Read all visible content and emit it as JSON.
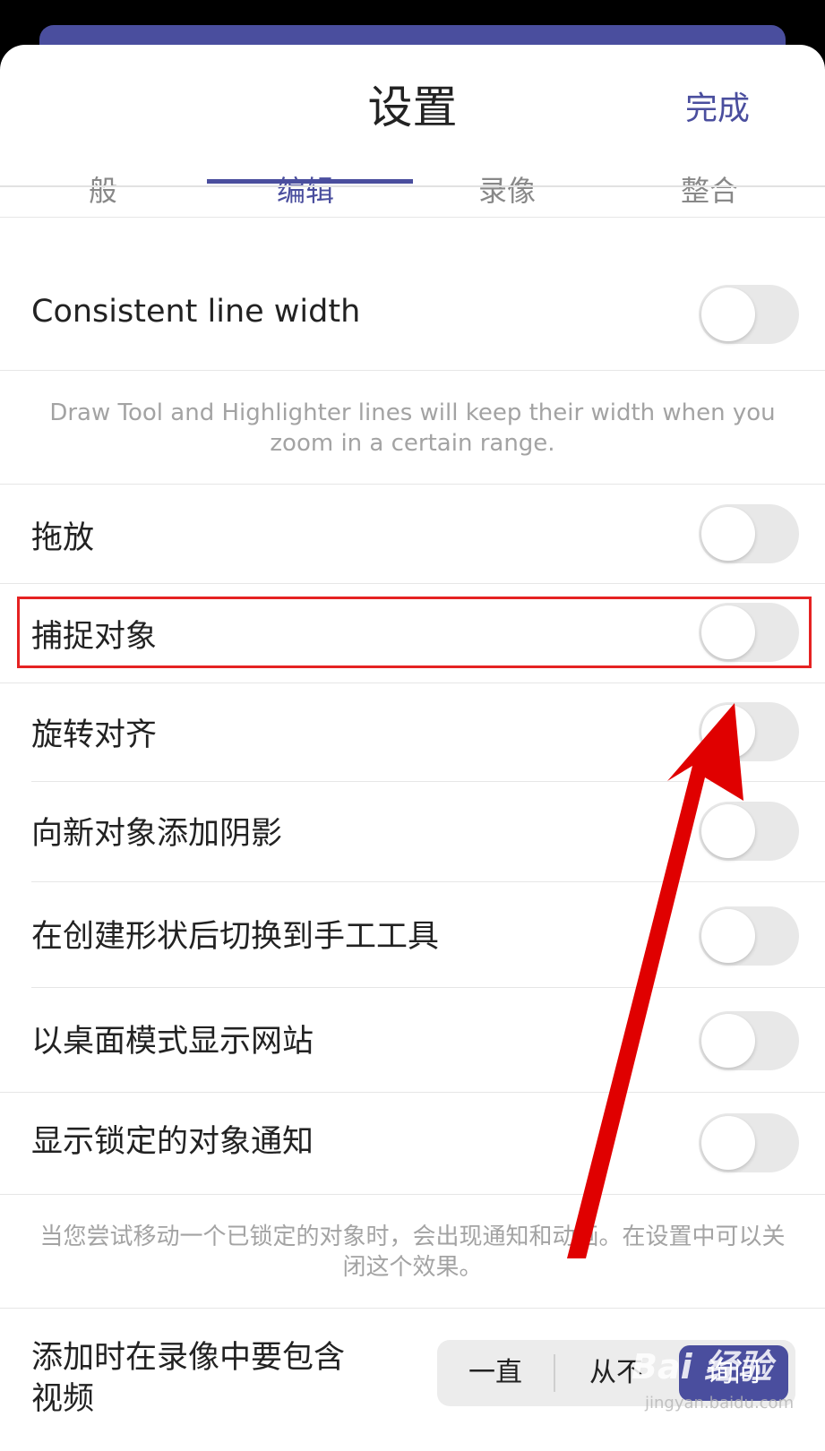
{
  "header": {
    "title": "设置",
    "done_label": "完成"
  },
  "tabs": [
    {
      "label": "般"
    },
    {
      "label": "编辑"
    },
    {
      "label": "录像"
    },
    {
      "label": "整合"
    }
  ],
  "active_tab": "编辑",
  "settings": {
    "consistent_line_width": {
      "label": "Consistent line width",
      "enabled": false
    },
    "consistent_line_width_hint": "Draw Tool and Highlighter lines will keep their width when you zoom in a certain range.",
    "drag_drop": {
      "label": "拖放",
      "enabled": false
    },
    "snap_objects": {
      "label": "捕捉对象",
      "enabled": false
    },
    "rotation_align": {
      "label": "旋转对齐",
      "enabled": false
    },
    "shadow_new_objects": {
      "label": "向新对象添加阴影",
      "enabled": false
    },
    "switch_hand_tool": {
      "label": "在创建形状后切换到手工工具",
      "enabled": false
    },
    "desktop_mode": {
      "label": "以桌面模式显示网站",
      "enabled": false
    },
    "locked_object_notice": {
      "label": "显示锁定的对象通知",
      "enabled": false
    },
    "locked_object_hint": "当您尝试移动一个已锁定的对象时，会出现通知和动画。在设置中可以关闭这个效果。",
    "include_video": {
      "label_line1": "添加时在录像中要包含",
      "label_line2": "视频",
      "options": [
        "一直",
        "从不",
        "询问"
      ],
      "selected": "询问"
    }
  },
  "watermark": {
    "brand": "Bai 经验",
    "url": "jingyan.baidu.com"
  },
  "colors": {
    "accent": "#4a4e9e",
    "highlight_box": "#e52222",
    "arrow": "#e00000"
  }
}
